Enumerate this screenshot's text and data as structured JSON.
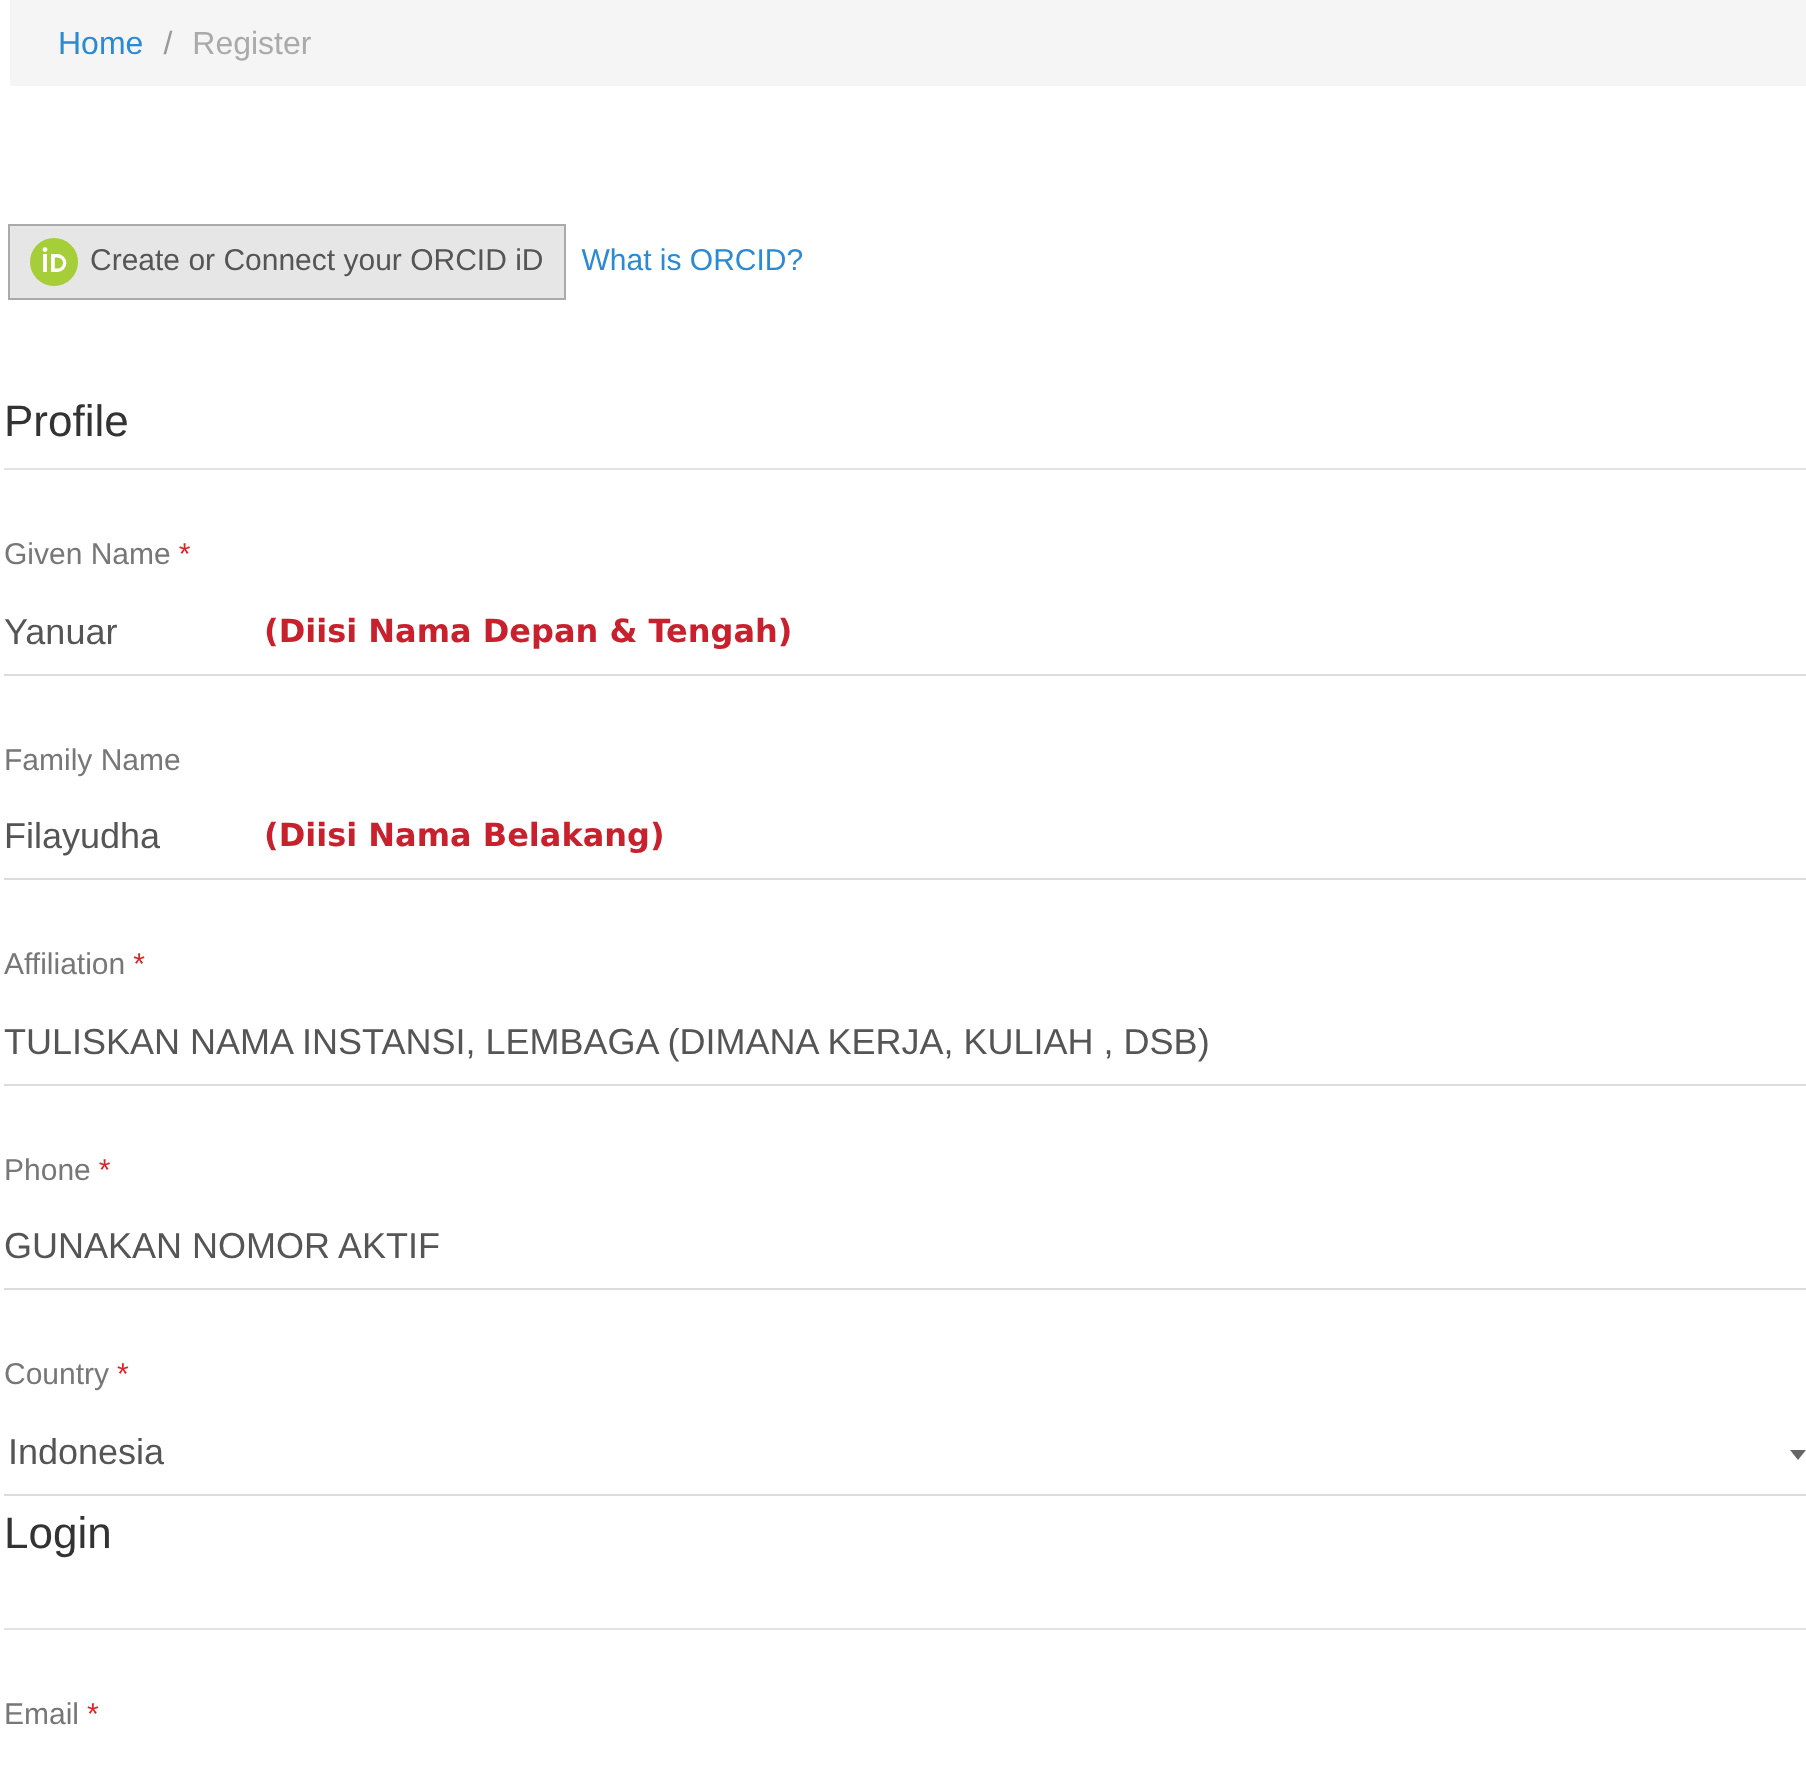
{
  "breadcrumb": [
    {
      "label": "Home",
      "kind": "link"
    },
    {
      "label": "Register",
      "kind": "current"
    }
  ],
  "separator": "/",
  "orcid": {
    "button": "Create or Connect your ORCID iD",
    "link": "What is ORCID?"
  },
  "sections": [
    {
      "title": "Profile",
      "fields": [
        {
          "kind": "text",
          "label": "Given Name",
          "required": true,
          "value": "Yanuar",
          "annotation": "(Diisi Nama Depan & Tengah)"
        },
        {
          "kind": "text",
          "label": "Family Name",
          "required": false,
          "value": "Filayudha",
          "annotation": "(Diisi Nama Belakang)"
        },
        {
          "kind": "text",
          "label": "Affiliation",
          "required": true,
          "value": "TULISKAN NAMA INSTANSI, LEMBAGA (DIMANA KERJA, KULIAH , DSB)"
        },
        {
          "kind": "text",
          "label": "Phone",
          "required": true,
          "value": "GUNAKAN NOMOR AKTIF"
        },
        {
          "kind": "select",
          "label": "Country",
          "required": true,
          "value": "Indonesia"
        }
      ]
    },
    {
      "title": "Login",
      "fields": [
        {
          "kind": "cut",
          "label": "Email",
          "required": true
        }
      ]
    }
  ],
  "required_mark": "*"
}
